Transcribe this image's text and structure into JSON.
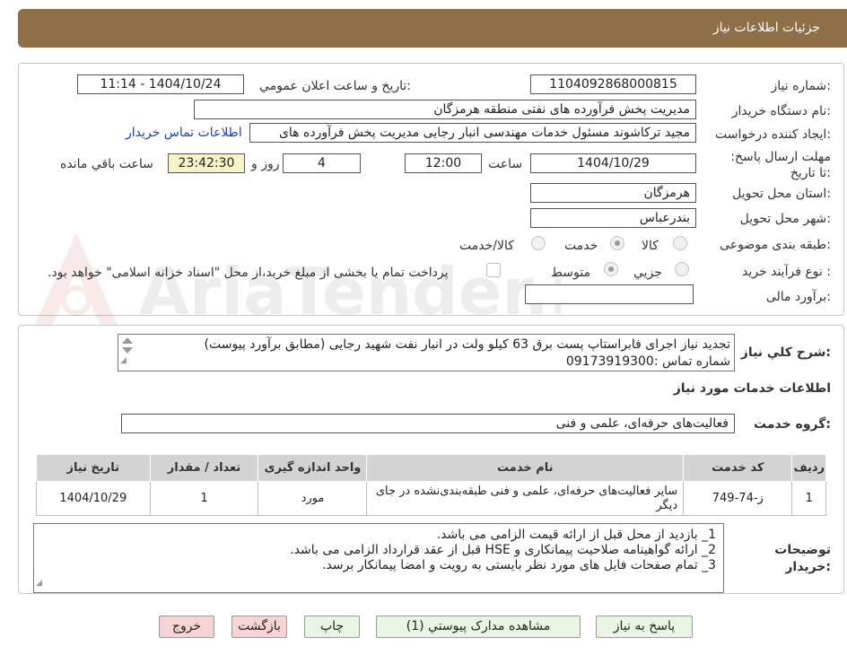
{
  "header": {
    "title": "جزئیات اطلاعات نیاز"
  },
  "form": {
    "need_number_label": "شماره نیاز:",
    "need_number": "1104092868000815",
    "announce_label": "تاریخ و ساعت اعلان عمومي:",
    "announce_value": "1404/10/24 - 11:14",
    "buyer_org_label": "نام دستگاه خریدار:",
    "buyer_org": "مدیریت پخش فرآورده های نفتی منطقه هرمزگان",
    "creator_label": "ایجاد کننده درخواست:",
    "creator": "مجید ترکاشوند مسئول خدمات مهندسی انبار رجایی مدیریت پخش فرآورده های",
    "contact_link": "اطلاعات تماس خریدار",
    "deadline_label": "مهلت ارسال پاسخ: تا تاریخ:",
    "deadline_date": "1404/10/29",
    "time_label": "ساعت",
    "deadline_time": "12:00",
    "days_value": "4",
    "days_label": "روز و",
    "remaining_time": "23:42:30",
    "remaining_label": "ساعت باقي مانده",
    "province_label": "استان محل تحویل:",
    "province": "هرمزگان",
    "city_label": "شهر محل تحویل:",
    "city": "بندرعباس",
    "category_label": "طبقه بندی موضوعی:",
    "category_options": [
      "کالا",
      "خدمت",
      "کالا/خدمت"
    ],
    "category_selected": "خدمت",
    "process_label": "نوع فرآیند خرید :",
    "process_options": [
      "جزيي",
      "متوسط"
    ],
    "process_selected": "متوسط",
    "payment_note": "پرداخت تمام یا بخشی از مبلغ خرید،از محل \"اسناد خزانه اسلامی\" خواهد بود.",
    "budget_label": "برآورد مالی:",
    "budget_value": ""
  },
  "description": {
    "label": "شرح کلي نیاز:",
    "line1": "تجدید نیاز اجرای فابراستاپ پست برق 63 کیلو ولت در انبار نفت شهید رجایی (مطابق برآورد پیوست)",
    "line2": "شماره تماس :09173919300"
  },
  "services": {
    "section_title": "اطلاعات خدمات مورد نیاز",
    "group_label": "گروه خدمت:",
    "group_value": "فعالیت‌های حرفه‌ای، علمی و فنی",
    "table": {
      "headers": [
        "رديف",
        "کد خدمت",
        "نام خدمت",
        "واحد اندازه گیری",
        "تعداد / مقدار",
        "تاریخ نیاز"
      ],
      "rows": [
        {
          "row": "1",
          "code": "ز-74-749",
          "name": "سایر فعالیت‌های حرفه‌ای، علمی و فنی طبقه‌بندی‌نشده در جای دیگر",
          "unit": "مورد",
          "qty": "1",
          "date": "1404/10/29"
        }
      ]
    }
  },
  "buyer_notes": {
    "label": "توضیحات خریدار:",
    "lines": [
      "1_    بازدید از محل قبل از ارائه قیمت الزامی می باشد.",
      "2_    ارائه گواهینامه صلاحیت پیمانکاری و HSE قبل از عقد قرارداد الزامی می باشد.",
      "3_    تمام صفحات فایل های مورد نظر بایستی به رویت و امضا پیمانکار برسد."
    ]
  },
  "buttons": {
    "reply": "پاسخ به نیاز",
    "attachments": "مشاهده مدارک پیوستي (1)",
    "print": "چاپ",
    "back": "بازگشت",
    "exit": "خروج"
  },
  "watermark": {
    "text": "AriaTender.net"
  }
}
